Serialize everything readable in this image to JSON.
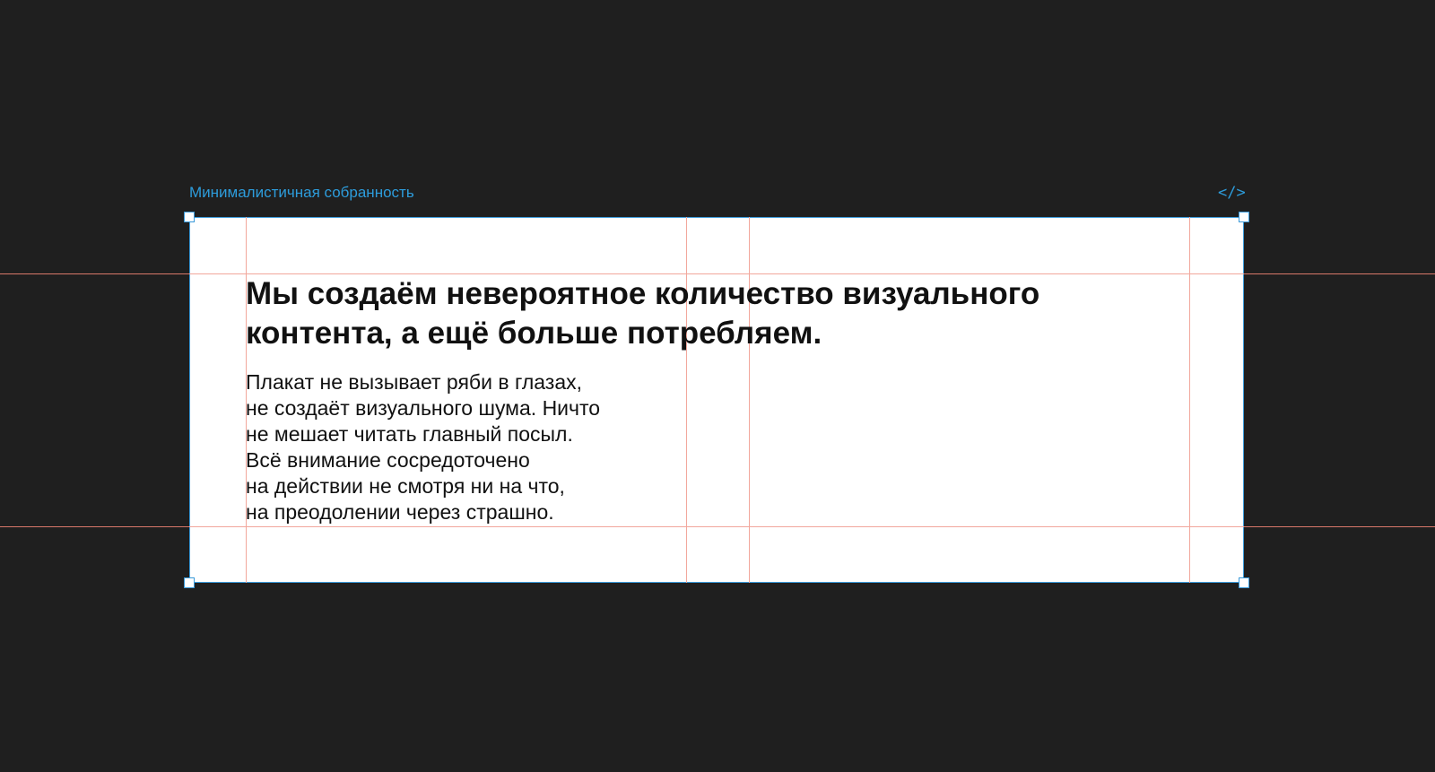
{
  "frame": {
    "name": "Минималистичная собранность",
    "code_icon_glyph": "</>",
    "code_icon": "code-icon"
  },
  "poster": {
    "headline": "Мы создаём невероятное количество визуального\nконтента, а ещё больше потребляем.",
    "body": "Плакат не вызывает ряби в глазах,\nне создаёт визуального шума. Ничто\nне мешает читать главный посыл.\nВсё внимание сосредоточено\nна действии не смотря ни на что,\nна преодолении через страшно."
  },
  "colors": {
    "background": "#1f1f1f",
    "selection": "#3a9ad9",
    "label": "#2d9cdb",
    "guides": "#f2a79c"
  }
}
